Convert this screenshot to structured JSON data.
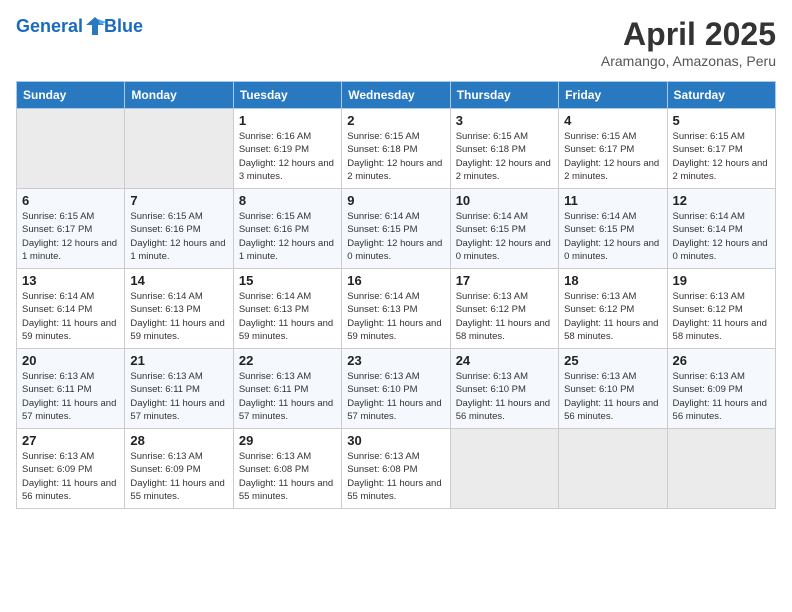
{
  "header": {
    "logo_line1": "General",
    "logo_line2": "Blue",
    "month_year": "April 2025",
    "location": "Aramango, Amazonas, Peru"
  },
  "weekdays": [
    "Sunday",
    "Monday",
    "Tuesday",
    "Wednesday",
    "Thursday",
    "Friday",
    "Saturday"
  ],
  "weeks": [
    [
      {
        "day": "",
        "empty": true
      },
      {
        "day": "",
        "empty": true
      },
      {
        "day": "1",
        "sunrise": "6:16 AM",
        "sunset": "6:19 PM",
        "daylight": "12 hours and 3 minutes."
      },
      {
        "day": "2",
        "sunrise": "6:15 AM",
        "sunset": "6:18 PM",
        "daylight": "12 hours and 2 minutes."
      },
      {
        "day": "3",
        "sunrise": "6:15 AM",
        "sunset": "6:18 PM",
        "daylight": "12 hours and 2 minutes."
      },
      {
        "day": "4",
        "sunrise": "6:15 AM",
        "sunset": "6:17 PM",
        "daylight": "12 hours and 2 minutes."
      },
      {
        "day": "5",
        "sunrise": "6:15 AM",
        "sunset": "6:17 PM",
        "daylight": "12 hours and 2 minutes."
      }
    ],
    [
      {
        "day": "6",
        "sunrise": "6:15 AM",
        "sunset": "6:17 PM",
        "daylight": "12 hours and 1 minute."
      },
      {
        "day": "7",
        "sunrise": "6:15 AM",
        "sunset": "6:16 PM",
        "daylight": "12 hours and 1 minute."
      },
      {
        "day": "8",
        "sunrise": "6:15 AM",
        "sunset": "6:16 PM",
        "daylight": "12 hours and 1 minute."
      },
      {
        "day": "9",
        "sunrise": "6:14 AM",
        "sunset": "6:15 PM",
        "daylight": "12 hours and 0 minutes."
      },
      {
        "day": "10",
        "sunrise": "6:14 AM",
        "sunset": "6:15 PM",
        "daylight": "12 hours and 0 minutes."
      },
      {
        "day": "11",
        "sunrise": "6:14 AM",
        "sunset": "6:15 PM",
        "daylight": "12 hours and 0 minutes."
      },
      {
        "day": "12",
        "sunrise": "6:14 AM",
        "sunset": "6:14 PM",
        "daylight": "12 hours and 0 minutes."
      }
    ],
    [
      {
        "day": "13",
        "sunrise": "6:14 AM",
        "sunset": "6:14 PM",
        "daylight": "11 hours and 59 minutes."
      },
      {
        "day": "14",
        "sunrise": "6:14 AM",
        "sunset": "6:13 PM",
        "daylight": "11 hours and 59 minutes."
      },
      {
        "day": "15",
        "sunrise": "6:14 AM",
        "sunset": "6:13 PM",
        "daylight": "11 hours and 59 minutes."
      },
      {
        "day": "16",
        "sunrise": "6:14 AM",
        "sunset": "6:13 PM",
        "daylight": "11 hours and 59 minutes."
      },
      {
        "day": "17",
        "sunrise": "6:13 AM",
        "sunset": "6:12 PM",
        "daylight": "11 hours and 58 minutes."
      },
      {
        "day": "18",
        "sunrise": "6:13 AM",
        "sunset": "6:12 PM",
        "daylight": "11 hours and 58 minutes."
      },
      {
        "day": "19",
        "sunrise": "6:13 AM",
        "sunset": "6:12 PM",
        "daylight": "11 hours and 58 minutes."
      }
    ],
    [
      {
        "day": "20",
        "sunrise": "6:13 AM",
        "sunset": "6:11 PM",
        "daylight": "11 hours and 57 minutes."
      },
      {
        "day": "21",
        "sunrise": "6:13 AM",
        "sunset": "6:11 PM",
        "daylight": "11 hours and 57 minutes."
      },
      {
        "day": "22",
        "sunrise": "6:13 AM",
        "sunset": "6:11 PM",
        "daylight": "11 hours and 57 minutes."
      },
      {
        "day": "23",
        "sunrise": "6:13 AM",
        "sunset": "6:10 PM",
        "daylight": "11 hours and 57 minutes."
      },
      {
        "day": "24",
        "sunrise": "6:13 AM",
        "sunset": "6:10 PM",
        "daylight": "11 hours and 56 minutes."
      },
      {
        "day": "25",
        "sunrise": "6:13 AM",
        "sunset": "6:10 PM",
        "daylight": "11 hours and 56 minutes."
      },
      {
        "day": "26",
        "sunrise": "6:13 AM",
        "sunset": "6:09 PM",
        "daylight": "11 hours and 56 minutes."
      }
    ],
    [
      {
        "day": "27",
        "sunrise": "6:13 AM",
        "sunset": "6:09 PM",
        "daylight": "11 hours and 56 minutes."
      },
      {
        "day": "28",
        "sunrise": "6:13 AM",
        "sunset": "6:09 PM",
        "daylight": "11 hours and 55 minutes."
      },
      {
        "day": "29",
        "sunrise": "6:13 AM",
        "sunset": "6:08 PM",
        "daylight": "11 hours and 55 minutes."
      },
      {
        "day": "30",
        "sunrise": "6:13 AM",
        "sunset": "6:08 PM",
        "daylight": "11 hours and 55 minutes."
      },
      {
        "day": "",
        "empty": true
      },
      {
        "day": "",
        "empty": true
      },
      {
        "day": "",
        "empty": true
      }
    ]
  ]
}
